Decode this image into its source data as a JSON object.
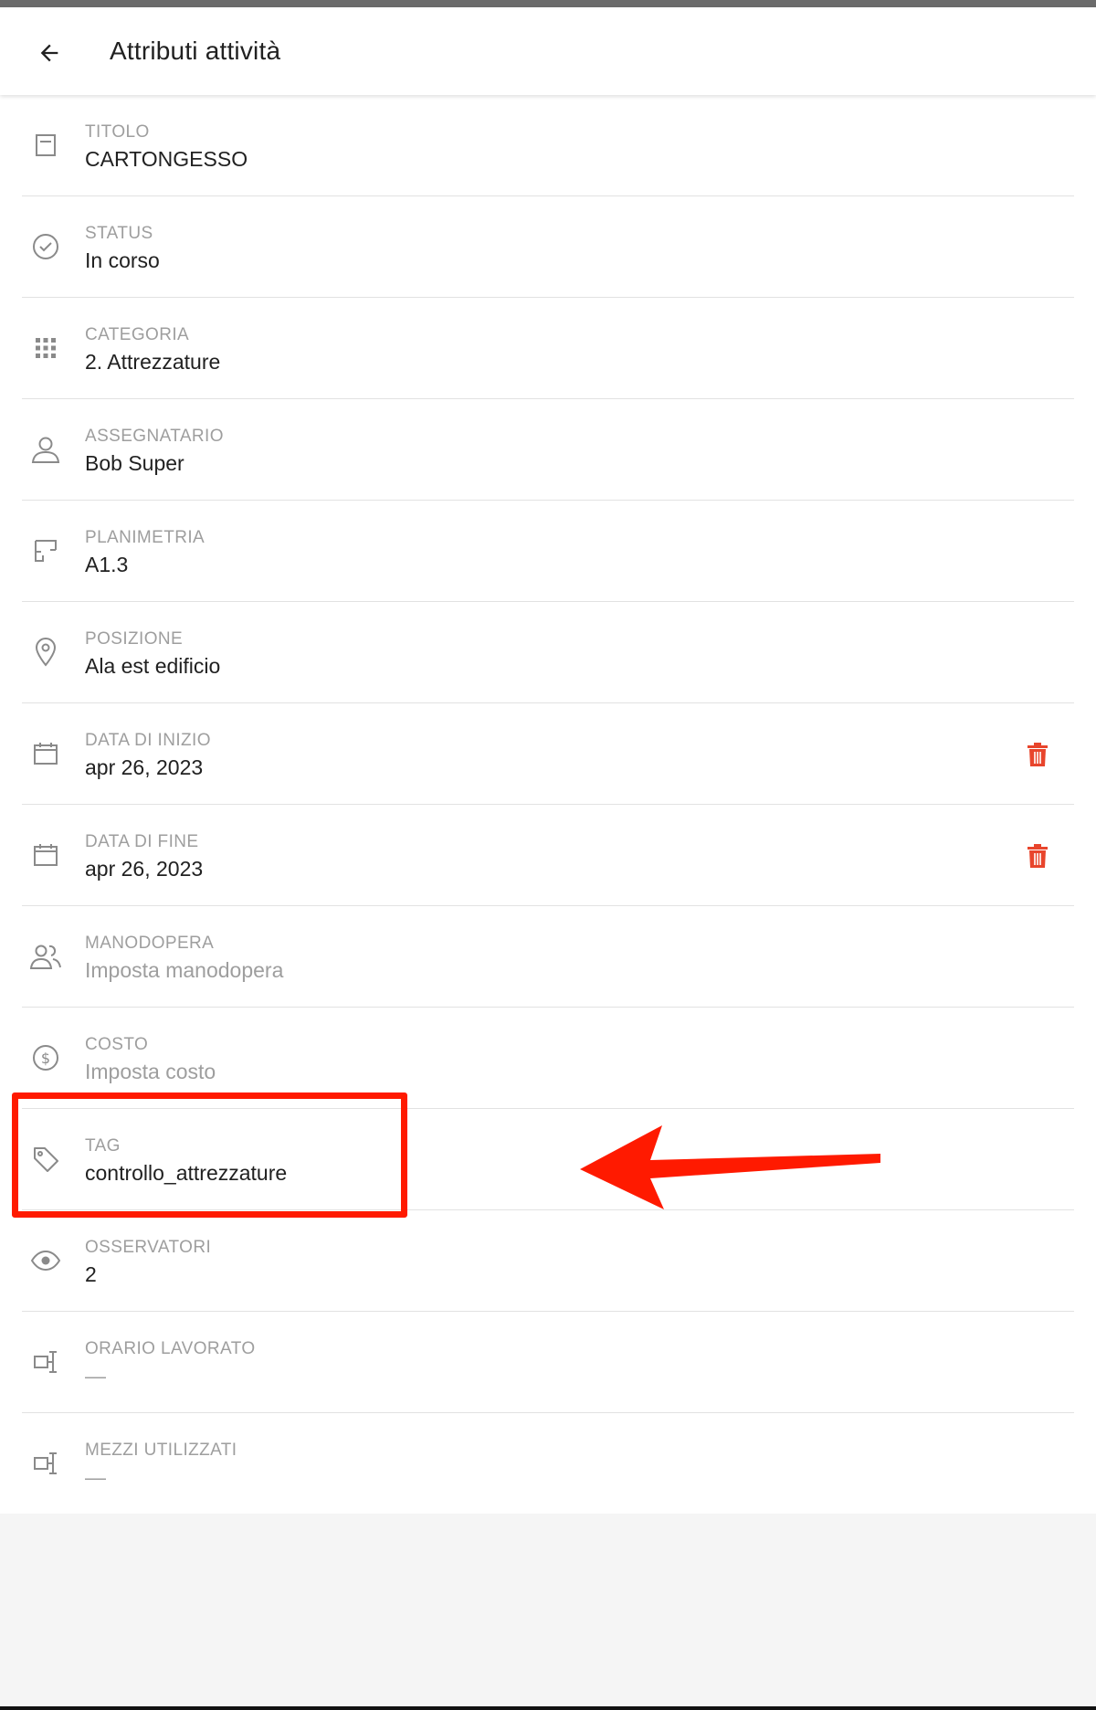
{
  "header": {
    "title": "Attributi attività",
    "back_icon": "arrow-left-icon"
  },
  "colors": {
    "accent_red": "#e8452c",
    "annotation_red": "#ff1a00",
    "label_grey": "#9e9e9e",
    "text_dark": "#212121"
  },
  "attributes": [
    {
      "label": "TITOLO",
      "value": "CARTONGESSO",
      "icon": "title-icon"
    },
    {
      "label": "STATUS",
      "value": "In corso",
      "icon": "check-circle-icon"
    },
    {
      "label": "CATEGORIA",
      "value": "2. Attrezzature",
      "icon": "grid-dots-icon"
    },
    {
      "label": "ASSEGNATARIO",
      "value": "Bob Super",
      "icon": "user-icon"
    },
    {
      "label": "PLANIMETRIA",
      "value": "A1.3",
      "icon": "floorplan-icon"
    },
    {
      "label": "POSIZIONE",
      "value": "Ala est edificio",
      "icon": "location-pin-icon"
    },
    {
      "label": "DATA DI INIZIO",
      "value": "apr 26, 2023",
      "icon": "calendar-icon",
      "action_icon": "trash-icon"
    },
    {
      "label": "DATA DI FINE",
      "value": "apr 26, 2023",
      "icon": "calendar-icon",
      "action_icon": "trash-icon"
    },
    {
      "label": "MANODOPERA",
      "value": "Imposta manodopera",
      "icon": "users-icon",
      "placeholder": true
    },
    {
      "label": "COSTO",
      "value": "Imposta costo",
      "icon": "dollar-circle-icon",
      "placeholder": true
    },
    {
      "label": "TAG",
      "value": "controllo_attrezzature",
      "icon": "tag-icon"
    },
    {
      "label": "OSSERVATORI",
      "value": "2",
      "icon": "eye-icon"
    },
    {
      "label": "ORARIO LAVORATO",
      "value": "—",
      "icon": "timesheet-icon",
      "placeholder": true
    },
    {
      "label": "MEZZI UTILIZZATI",
      "value": "—",
      "icon": "equipment-icon",
      "placeholder": true
    }
  ]
}
